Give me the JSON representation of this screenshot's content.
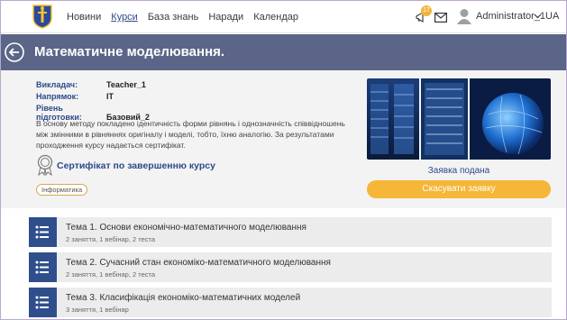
{
  "nav": {
    "items": [
      {
        "label": "Новини",
        "active": false
      },
      {
        "label": "Курси",
        "active": true
      },
      {
        "label": "База знань",
        "active": false
      },
      {
        "label": "Наради",
        "active": false
      },
      {
        "label": "Календар",
        "active": false
      }
    ],
    "notification_count": "17",
    "username": "Administrator_1",
    "language": "UA"
  },
  "course": {
    "title": "Математичне моделювання.",
    "teacher_label": "Викладач:",
    "teacher": "Teacher_1",
    "direction_label": "Напрямок:",
    "direction": "IT",
    "level_label": "Рівень підготовки:",
    "level": "Базовий_2",
    "description": "В основу методу покладено ідентичність форми рівнянь і однозначність співвідношень між змінними в рівняннях оригіналу і моделі, тобто, їхню аналогію. За результатами проходження курсу надається сертифікат.",
    "certificate_label": "Сертифікат по завершенню курсу",
    "tag": "Інформатика",
    "status": "Заявка подана",
    "cancel_label": "Скасувати заявку"
  },
  "topics": [
    {
      "title": "Тема 1. Основи економічно-математичного моделювання",
      "meta": "2 заняття, 1 вебінар, 2 теста"
    },
    {
      "title": "Тема 2. Сучасний стан економіко-математичного моделювання",
      "meta": "2 заняття, 1 вебінар, 2 теста"
    },
    {
      "title": "Тема 3. Класифікація економіко-математичних моделей",
      "meta": "3 заняття, 1 вебінар"
    }
  ],
  "colors": {
    "accent": "#2c4a8a",
    "titlebar": "#5a6587",
    "button": "#f6b637",
    "badge": "#f2b43a"
  }
}
